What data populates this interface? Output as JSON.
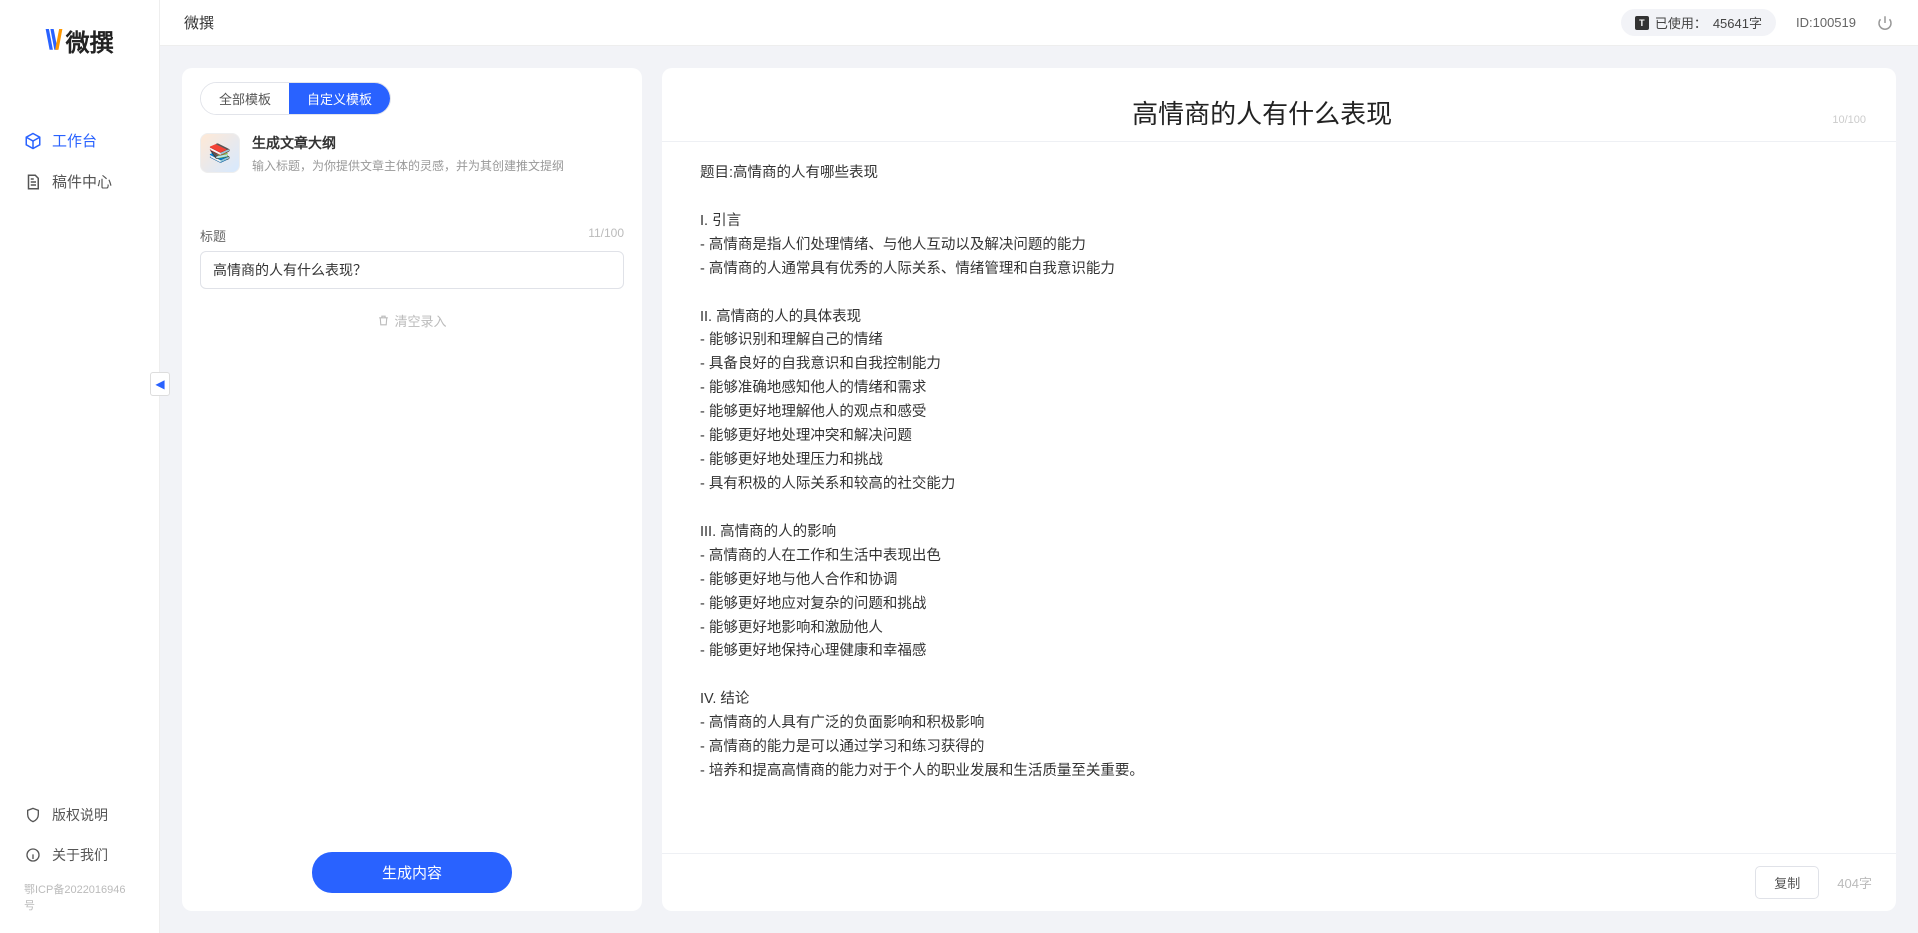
{
  "brand": {
    "name": "微撰"
  },
  "topbar": {
    "title": "微撰",
    "usage_label": "已使用：",
    "usage_value": "45641字",
    "user_id_label": "ID:",
    "user_id_value": "100519"
  },
  "sidebar": {
    "nav": [
      {
        "label": "工作台",
        "icon": "cube-icon",
        "active": true
      },
      {
        "label": "稿件中心",
        "icon": "document-icon",
        "active": false
      }
    ],
    "bottom": [
      {
        "label": "版权说明",
        "icon": "shield-icon"
      },
      {
        "label": "关于我们",
        "icon": "info-icon"
      }
    ],
    "icp": "鄂ICP备2022016946号"
  },
  "left_panel": {
    "tabs": [
      {
        "label": "全部模板",
        "active": false
      },
      {
        "label": "自定义模板",
        "active": true
      }
    ],
    "template": {
      "title": "生成文章大纲",
      "desc": "输入标题，为你提供文章主体的灵感，并为其创建推文提纲"
    },
    "form": {
      "title_label": "标题",
      "title_value": "高情商的人有什么表现？",
      "title_counter": "11/100",
      "clear_label": "清空录入"
    },
    "generate_label": "生成内容"
  },
  "right_panel": {
    "title": "高情商的人有什么表现",
    "title_counter": "10/100",
    "body": "题目:高情商的人有哪些表现\n\nI. 引言\n- 高情商是指人们处理情绪、与他人互动以及解决问题的能力\n- 高情商的人通常具有优秀的人际关系、情绪管理和自我意识能力\n\nII. 高情商的人的具体表现\n- 能够识别和理解自己的情绪\n- 具备良好的自我意识和自我控制能力\n- 能够准确地感知他人的情绪和需求\n- 能够更好地理解他人的观点和感受\n- 能够更好地处理冲突和解决问题\n- 能够更好地处理压力和挑战\n- 具有积极的人际关系和较高的社交能力\n\nIII. 高情商的人的影响\n- 高情商的人在工作和生活中表现出色\n- 能够更好地与他人合作和协调\n- 能够更好地应对复杂的问题和挑战\n- 能够更好地影响和激励他人\n- 能够更好地保持心理健康和幸福感\n\nIV. 结论\n- 高情商的人具有广泛的负面影响和积极影响\n- 高情商的能力是可以通过学习和练习获得的\n- 培养和提高高情商的能力对于个人的职业发展和生活质量至关重要。",
    "copy_label": "复制",
    "word_count": "404字"
  }
}
